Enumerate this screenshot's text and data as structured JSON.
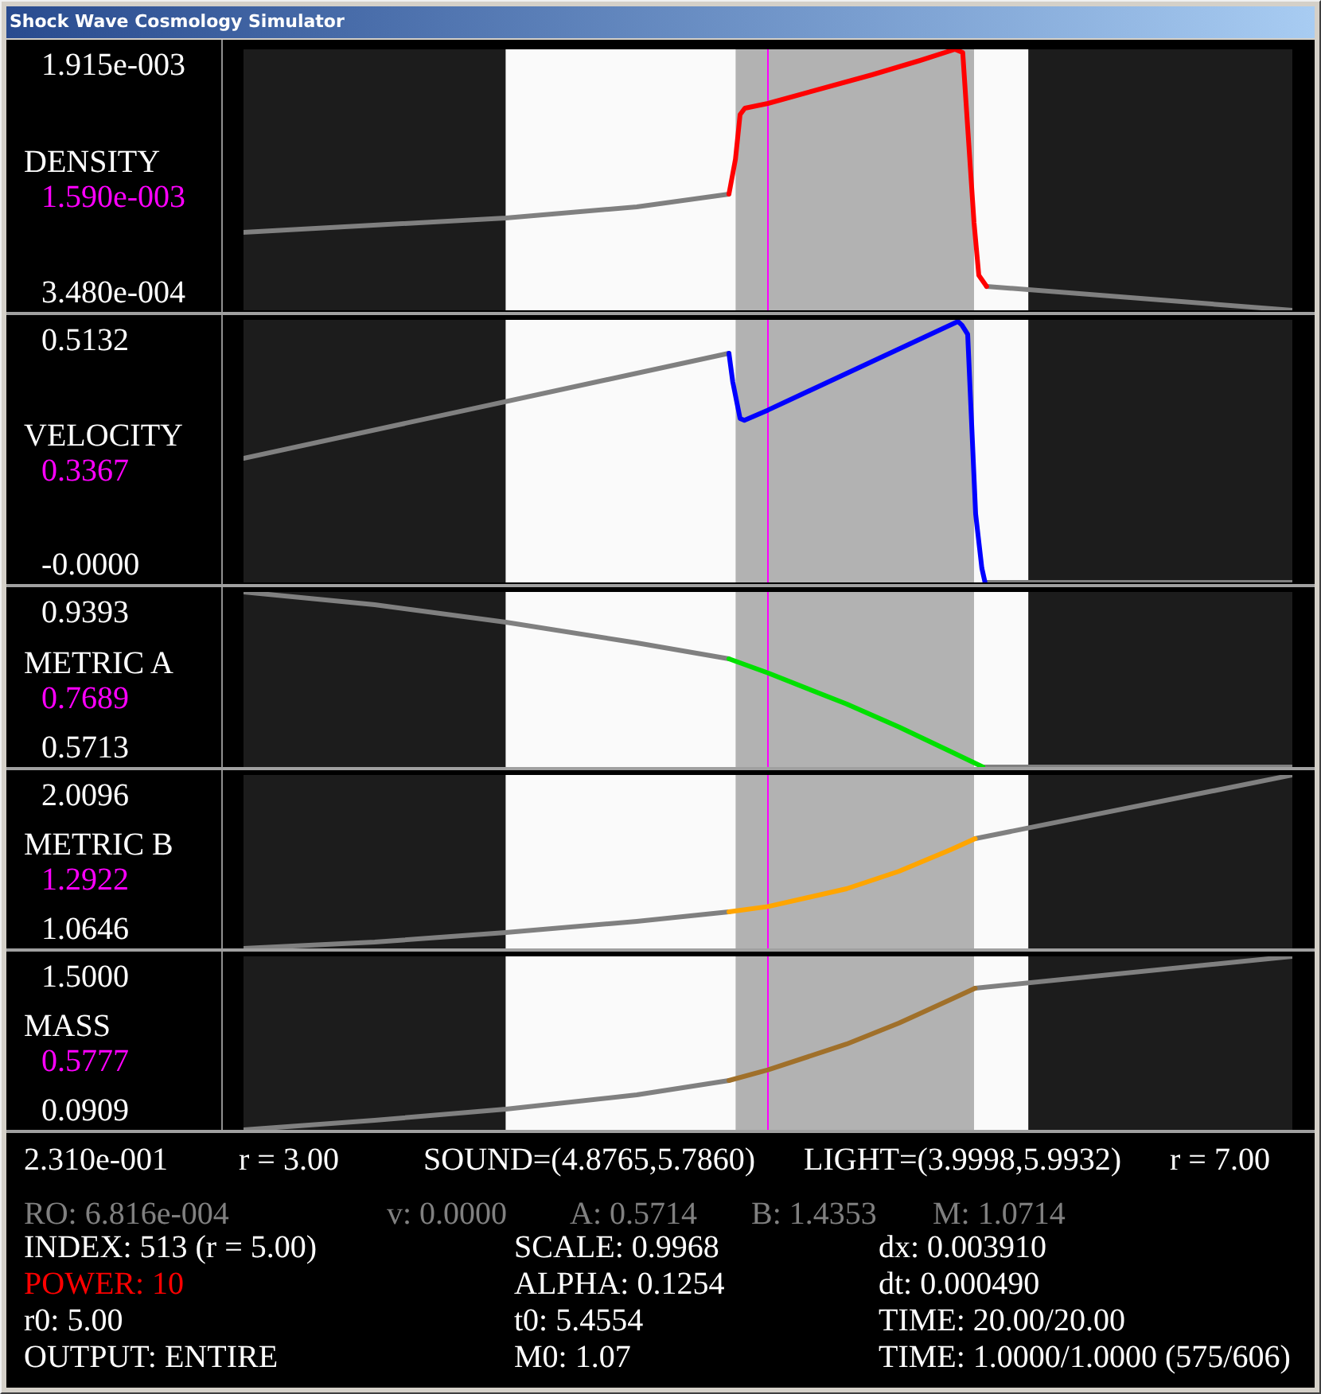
{
  "window": {
    "title": "Shock Wave Cosmology Simulator"
  },
  "panels": [
    {
      "max": "1.915e-003",
      "name": "DENSITY",
      "current": "1.590e-003",
      "min": "3.480e-004",
      "color": "#ff0000"
    },
    {
      "max": "0.5132",
      "name": "VELOCITY",
      "current": "0.3367",
      "min": "-0.0000",
      "color": "#0000ff"
    },
    {
      "max": "0.9393",
      "name": "METRIC A",
      "current": "0.7689",
      "min": "0.5713",
      "color": "#00e000"
    },
    {
      "max": "2.0096",
      "name": "METRIC B",
      "current": "1.2922",
      "min": "1.0646",
      "color": "#ffa500"
    },
    {
      "max": "1.5000",
      "name": "MASS",
      "current": "0.5777",
      "min": "0.0909",
      "color": "#a0702a"
    }
  ],
  "readouts": {
    "axis_line": [
      "2.310e-001",
      "r = 3.00",
      "SOUND=(4.8765,5.7860)",
      "LIGHT=(3.9998,5.9932)",
      "r = 7.00"
    ],
    "probe_line": [
      "RO: 6.816e-004",
      "v: 0.0000",
      "A: 0.5714",
      "B: 1.4353",
      "M: 1.0714"
    ],
    "parameters": [
      {
        "items": [
          {
            "text": "INDEX: 513 (r = 5.00)",
            "highlighted": false
          },
          {
            "text": "POWER: 10",
            "highlighted": true
          },
          {
            "text": "r0: 5.00",
            "highlighted": false
          },
          {
            "text": "OUTPUT: ENTIRE",
            "highlighted": false
          }
        ]
      },
      {
        "items": [
          {
            "text": "SCALE: 0.9968",
            "highlighted": false
          },
          {
            "text": "ALPHA: 0.1254",
            "highlighted": false
          },
          {
            "text": "t0: 5.4554",
            "highlighted": false
          },
          {
            "text": "M0: 1.07",
            "highlighted": false
          }
        ]
      },
      {
        "items": [
          {
            "text": "dx: 0.003910",
            "highlighted": false
          },
          {
            "text": "dt: 0.000490",
            "highlighted": false
          },
          {
            "text": "TIME: 20.00/20.00",
            "highlighted": false
          },
          {
            "text": "TIME: 1.0000/1.0000 (575/606)",
            "highlighted": false
          }
        ]
      }
    ]
  }
}
